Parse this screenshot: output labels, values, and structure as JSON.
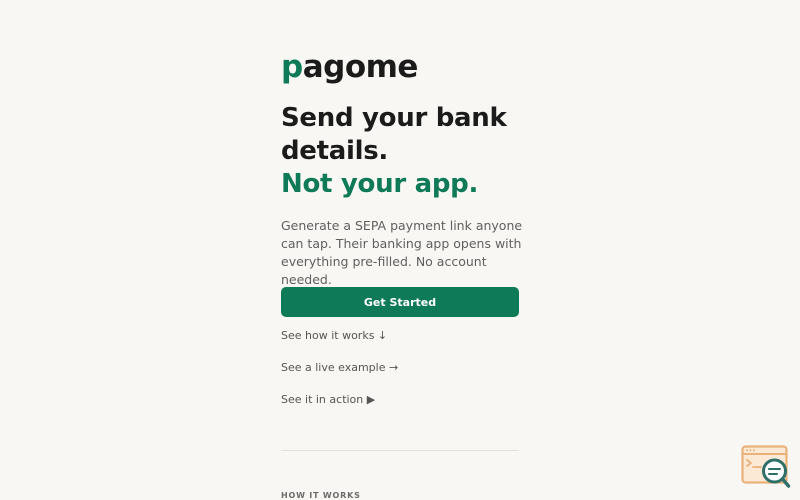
{
  "brand": {
    "logo_first": "p",
    "logo_rest": "agome",
    "accent_color": "#0f7a58"
  },
  "hero": {
    "headline_line1": "Send your bank",
    "headline_line2": "details.",
    "headline_line3": "Not your app.",
    "description": "Generate a SEPA payment link anyone can tap. Their banking app opens with everything pre-filled. No account needed."
  },
  "actions": {
    "get_started": "Get Started",
    "see_how": "See how it works ↓",
    "see_example": "See a live example →",
    "see_action": "See it in action ▶"
  },
  "how_it_works": {
    "label": "HOW IT WORKS"
  },
  "widget": {
    "icon": "browser-search-icon",
    "colors": {
      "outline": "#e9b27a",
      "glass": "#2f6f6a"
    }
  }
}
